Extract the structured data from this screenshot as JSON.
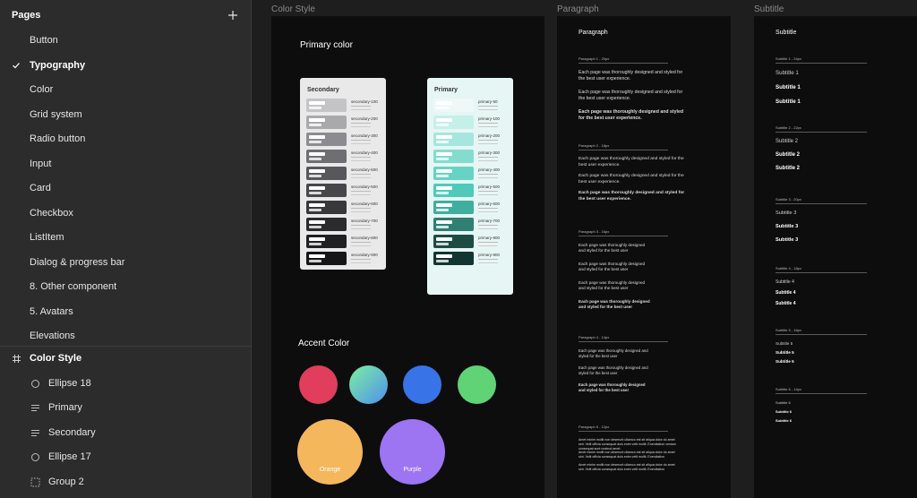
{
  "sidebar": {
    "title": "Pages",
    "pages": [
      {
        "label": "Button"
      },
      {
        "label": "Typography",
        "active": true
      },
      {
        "label": "Color"
      },
      {
        "label": "Grid system"
      },
      {
        "label": "Radio button"
      },
      {
        "label": "Input"
      },
      {
        "label": "Card"
      },
      {
        "label": "Checkbox"
      },
      {
        "label": "ListItem"
      },
      {
        "label": "Dialog & progress bar"
      },
      {
        "label": "8. Other component"
      },
      {
        "label": "5. Avatars"
      },
      {
        "label": "Elevations"
      }
    ],
    "layers": [
      {
        "label": "Color Style",
        "icon": "frame-icon"
      },
      {
        "label": "Ellipse 18",
        "icon": "ellipse-icon"
      },
      {
        "label": "Primary",
        "icon": "text-icon"
      },
      {
        "label": "Secondary",
        "icon": "text-icon"
      },
      {
        "label": "Ellipse 17",
        "icon": "ellipse-icon"
      },
      {
        "label": "Group 2",
        "icon": "group-icon"
      }
    ]
  },
  "canvas": {
    "frame_labels": {
      "color_style": "Color Style",
      "paragraph": "Paragraph",
      "subtitle": "Subtitle"
    },
    "color_style": {
      "primary_heading": "Primary color",
      "secondary_card": {
        "title": "Secondary",
        "swatches": [
          {
            "name": "secondary-100",
            "color": "#c4c4c6"
          },
          {
            "name": "secondary-200",
            "color": "#a9a9ac"
          },
          {
            "name": "secondary-300",
            "color": "#8c8c90"
          },
          {
            "name": "secondary-400",
            "color": "#6e6e73"
          },
          {
            "name": "secondary-500",
            "color": "#58585c"
          },
          {
            "name": "secondary-500",
            "color": "#47474b"
          },
          {
            "name": "secondary-600",
            "color": "#38383b"
          },
          {
            "name": "secondary-700",
            "color": "#2b2b2e"
          },
          {
            "name": "secondary-800",
            "color": "#202023"
          },
          {
            "name": "secondary-900",
            "color": "#161618"
          }
        ]
      },
      "primary_card": {
        "title": "Primary",
        "swatches": [
          {
            "name": "primary-50",
            "color": "#eef9f7"
          },
          {
            "name": "primary-100",
            "color": "#c5efe9"
          },
          {
            "name": "primary-200",
            "color": "#a6e6de"
          },
          {
            "name": "primary-300",
            "color": "#84dccf"
          },
          {
            "name": "primary-400",
            "color": "#67d3c5"
          },
          {
            "name": "primary-500",
            "color": "#4fc9ba"
          },
          {
            "name": "primary-600",
            "color": "#3fae9f"
          },
          {
            "name": "primary-700",
            "color": "#2f7f73"
          },
          {
            "name": "primary-800",
            "color": "#1d4c45"
          },
          {
            "name": "primary-900",
            "color": "#123531"
          }
        ]
      },
      "accent_heading": "Accent Color",
      "accents": [
        {
          "name": "red",
          "color": "#e03e5c"
        },
        {
          "name": "gradient",
          "color": "#5ad1c0"
        },
        {
          "name": "blue",
          "color": "#3873e8"
        },
        {
          "name": "green",
          "color": "#5fd376"
        }
      ],
      "big_accents": [
        {
          "label": "Orange",
          "color": "#f5b75c"
        },
        {
          "label": "Purple",
          "color": "#9d74f2"
        }
      ]
    },
    "paragraph": {
      "title": "Paragraph",
      "sections": [
        {
          "label": "Paragraph 1 - 20px",
          "lines": [
            "Each page was thoroughly designed and styled for the best user experience.",
            "Each page was thoroughly designed and styled for the best user experience.",
            "Each page was thoroughly designed and styled for the best user experience."
          ]
        },
        {
          "label": "Paragraph 2 - 18px",
          "lines": [
            "Each page was thoroughly designed and styled for the best user experience.",
            "Each page was thoroughly designed and styled for the best user experience.",
            "Each page was thoroughly designed and styled for the best user experience."
          ]
        },
        {
          "label": "Paragraph 3 - 16px",
          "lines": [
            "Each page was thoroughly designed and styled for the best user",
            "Each page was thoroughly designed and styled for the best user",
            "Each page was thoroughly designed and styled for the best user",
            "Each page was thoroughly designed and styled for the best user"
          ]
        },
        {
          "label": "Paragraph 4 - 14px",
          "lines": [
            "Each page was thoroughly designed and styled for the best user",
            "Each page was thoroughly designed and styled for the best user",
            "Each page was thoroughly designed and styled for the best user"
          ]
        },
        {
          "label": "Paragraph 5 - 12px",
          "lines": [
            "Amet minim mollit non deserunt ullamco est sit aliqua dolor do amet sint. Velit officia consequat duis enim velit mollit. Exercitation veniam consequat sunt nostrud amet.",
            "Amet minim mollit non deserunt ullamco est sit aliqua dolor do amet sint. Velit officia consequat duis enim velit mollit. Exercitation",
            "Amet minim mollit non deserunt ullamco est sit aliqua dolor do amet sint. Velit officia consequat duis enim velit mollit. Exercitation"
          ]
        }
      ]
    },
    "subtitle": {
      "title": "Subtitle",
      "sections": [
        {
          "label": "Subtitle 1 - 24px",
          "items": [
            "Subtitle 1",
            "Subtitle 1",
            "Subtitle 1"
          ]
        },
        {
          "label": "Subtitle 2 - 22px",
          "items": [
            "Subtitle 2",
            "Subtitle 2",
            "Subtitle 2"
          ]
        },
        {
          "label": "Subtitle 3 - 20px",
          "items": [
            "Subtitle 3",
            "Subtitle 3",
            "Subtitle 3"
          ]
        },
        {
          "label": "Subtitle 4 - 18px",
          "items": [
            "Subtitle 4",
            "Subtitle 4",
            "Subtitle 4"
          ]
        },
        {
          "label": "Subtitle 5 - 16px",
          "items": [
            "Subtitle 5",
            "Subtitle 5",
            "Subtitle 5"
          ]
        },
        {
          "label": "Subtitle 6 - 14px",
          "items": [
            "Subtitle 6",
            "Subtitle 6",
            "Subtitle 6"
          ]
        }
      ]
    }
  }
}
